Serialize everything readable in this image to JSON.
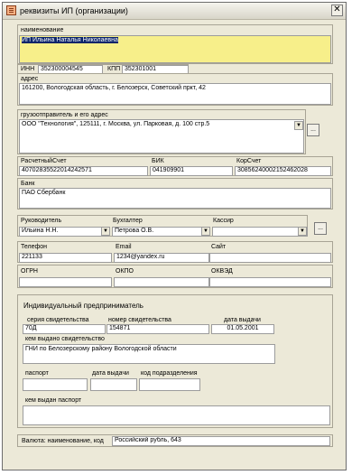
{
  "window": {
    "title": "реквизиты ИП (организации)",
    "close_glyph": "✕"
  },
  "name": {
    "label": "наименование",
    "value": "ИП Ильина Наталья Николаевна"
  },
  "inn": {
    "label": "ИНН",
    "value": "352300004545"
  },
  "kpp": {
    "label": "КПП",
    "value": "352301001"
  },
  "address": {
    "label": "адрес",
    "value": "161200, Вологодская область, г. Белозерск, Советский пркт, 42"
  },
  "consignee": {
    "label": "грузоотправитель и его адрес",
    "value": "ООО \"Технология\", 125111, г. Москва, ул. Парковая, д. 100 стр.5",
    "button": "..."
  },
  "bank_numbers": {
    "rs_label": "РасчетныйСчет",
    "rs_value": "40702835522014242571",
    "bik_label": "БИК",
    "bik_value": "041909901",
    "ks_label": "КорСчет",
    "ks_value": "30856240002152462028"
  },
  "bank": {
    "label": "Банк",
    "value": "ПАО Сбербанк"
  },
  "staff": {
    "head_label": "Руководитель",
    "head_value": "Ильина Н.Н.",
    "acc_label": "Бухгалтер",
    "acc_value": "Петрова О.В.",
    "cash_label": "Кассир",
    "cash_value": "",
    "button": "..."
  },
  "contacts": {
    "phone_label": "Телефон",
    "phone_value": "221133",
    "email_label": "Email",
    "email_value": "1234@yandex.ru",
    "site_label": "Сайт",
    "site_value": ""
  },
  "codes": {
    "ogrn_label": "ОГРН",
    "okpo_label": "ОКПО",
    "okved_label": "ОКВЭД"
  },
  "ip": {
    "title": "Индивидуальный предприниматель",
    "series_label": "серия свидетельства",
    "series_value": "70Д",
    "number_label": "номер свидетельства",
    "number_value": "154871",
    "issue_date_label": "дата выдачи",
    "issue_date_value": "01.05.2001",
    "issued_by_label": "кем выдано свидетельство",
    "issued_by_value": "ГНИ по Белозерскому району Вологодской области",
    "passport_label": "паспорт",
    "passport_date_label": "дата выдачи",
    "dept_code_label": "код подразделения",
    "passport_issued_label": "кем выдан паспорт"
  },
  "currency": {
    "label": "Валюта: наименование, код",
    "value": "Российский рубль, 643"
  }
}
